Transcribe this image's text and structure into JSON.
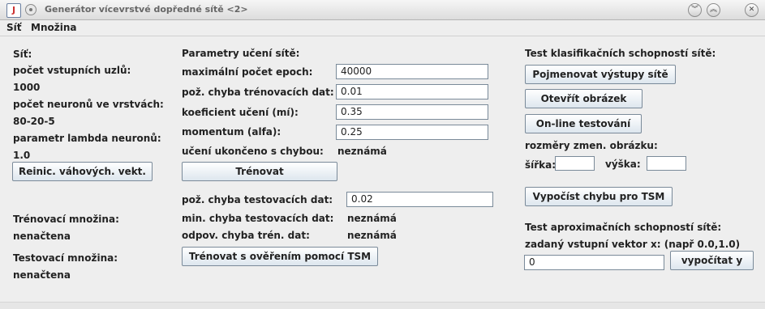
{
  "window": {
    "title": "Generátor vícevrstvé dopředné sítě <2>",
    "app_icon_glyph": "J",
    "collapse_glyph": "︾",
    "expand_glyph": "︽",
    "close_glyph": "✕"
  },
  "menu": {
    "items": [
      "Síť",
      "Množina"
    ]
  },
  "network": {
    "heading": "Síť:",
    "inputs_label": "počet vstupních uzlů:",
    "inputs_value": "1000",
    "layers_label": "počet neuronů ve vrstvách:",
    "layers_value": "80-20-5",
    "lambda_label": "parametr lambda neuronů:",
    "lambda_value": "1.0",
    "reinit_button": "Reinic. váhových. vekt.",
    "training_set_label": "Trénovací množina:",
    "training_set_status": "nenačtena",
    "test_set_label": "Testovací množina:",
    "test_set_status": "nenačtena"
  },
  "learning": {
    "heading": "Parametry učení sítě:",
    "max_epochs_label": "maximální počet epoch:",
    "max_epochs_value": "40000",
    "train_error_label": "pož. chyba trénovacích dat:",
    "train_error_value": "0.01",
    "rate_label": "koeficient učení (mí):",
    "rate_value": "0.35",
    "momentum_label": "momentum (alfa):",
    "momentum_value": "0.25",
    "finished_label": "učení ukončeno s chybou:",
    "finished_value": "neznámá",
    "train_button": "Trénovat",
    "test_error_label": "pož. chyba testovacích dat:",
    "test_error_value": "0.02",
    "min_test_error_label": "min. chyba testovacích dat:",
    "min_test_error_value": "neznámá",
    "corr_train_error_label": "odpov. chyba trén. dat:",
    "corr_train_error_value": "neznámá",
    "train_tsm_button": "Trénovat s ověřením pomocí TSM"
  },
  "classification": {
    "heading": "Test klasifikačních schopností sítě:",
    "name_outputs_button": "Pojmenovat výstupy sítě",
    "open_image_button": "Otevřít obrázek",
    "online_test_button": "On-line testování",
    "dims_label": "rozměry zmen. obrázku:",
    "width_label": "šířka:",
    "width_value": "",
    "height_label": "výška:",
    "height_value": "",
    "compute_error_button": "Vypočíst chybu pro TSM"
  },
  "approximation": {
    "heading": "Test aproximačních schopností sítě:",
    "vector_label": "zadaný vstupní vektor x: (např 0.0,1.0)",
    "vector_value": "0",
    "compute_button": "vypočítat y"
  }
}
